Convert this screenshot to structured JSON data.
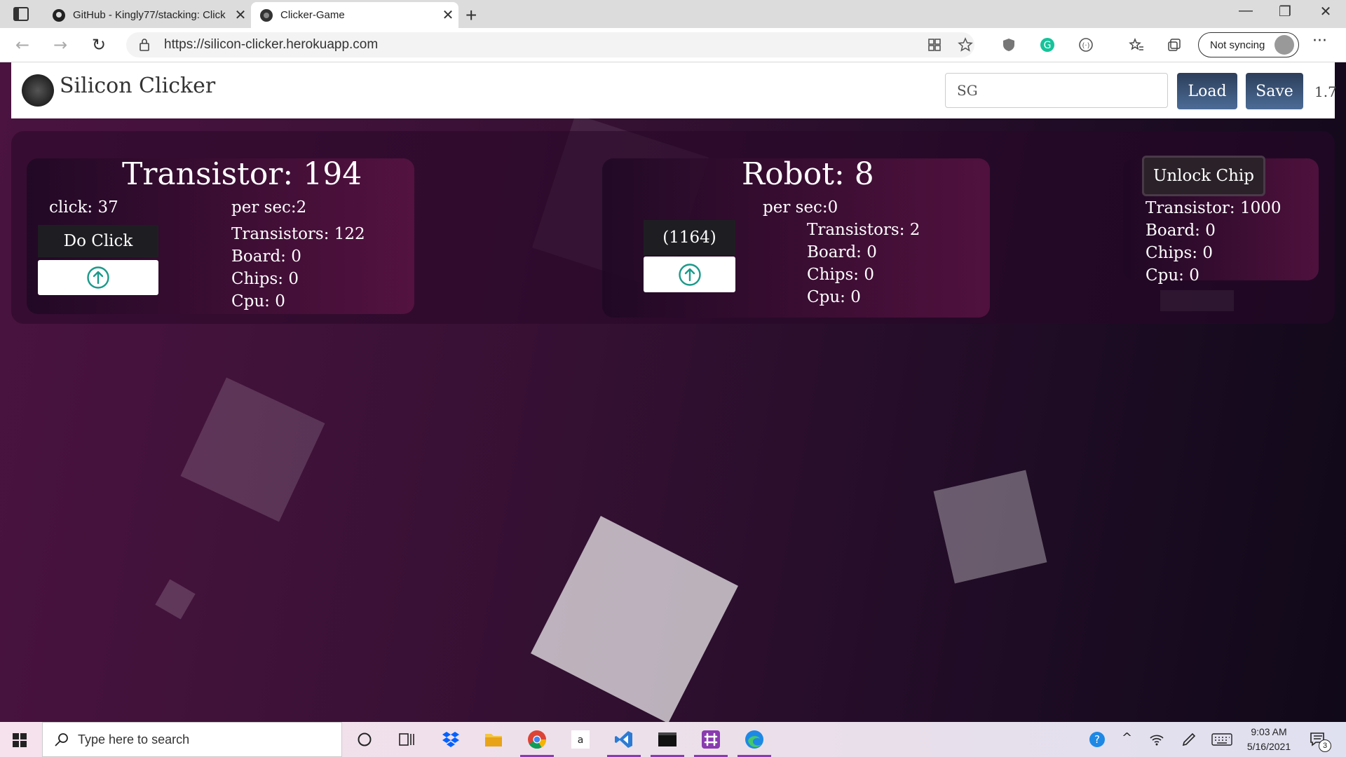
{
  "browser": {
    "tabs": [
      {
        "title": "GitHub - Kingly77/stacking: Click",
        "icon": "github-icon",
        "active": false
      },
      {
        "title": "Clicker-Game",
        "icon": "silicon-favicon",
        "active": true
      }
    ],
    "url": "https://silicon-clicker.herokuapp.com",
    "sync_label": "Not syncing"
  },
  "navbar": {
    "brand": "Silicon Clicker",
    "save_code": "SG",
    "load_label": "Load",
    "save_label": "Save",
    "version": "1.7"
  },
  "transistor": {
    "title": "Transistor: 194",
    "click": "click: 37",
    "do_click_label": "Do Click",
    "per_sec": "per sec:2",
    "costs": [
      "Transistors: 122",
      "Board: 0",
      "Chips: 0",
      "Cpu: 0"
    ]
  },
  "robot": {
    "title": "Robot: 8",
    "count_label": "(1164)",
    "per_sec": "per sec:0",
    "costs": [
      "Transistors: 2",
      "Board: 0",
      "Chips: 0",
      "Cpu: 0"
    ]
  },
  "chip": {
    "unlock_label": "Unlock Chip",
    "costs": [
      "Transistor: 1000",
      "Board: 0",
      "Chips: 0",
      "Cpu: 0"
    ]
  },
  "taskbar": {
    "search_placeholder": "Type here to search",
    "time": "9:03 AM",
    "date": "5/16/2021",
    "notification_count": "3"
  },
  "colors": {
    "accent_teal": "#1a9a8a",
    "button_blue": "#3c5678"
  }
}
